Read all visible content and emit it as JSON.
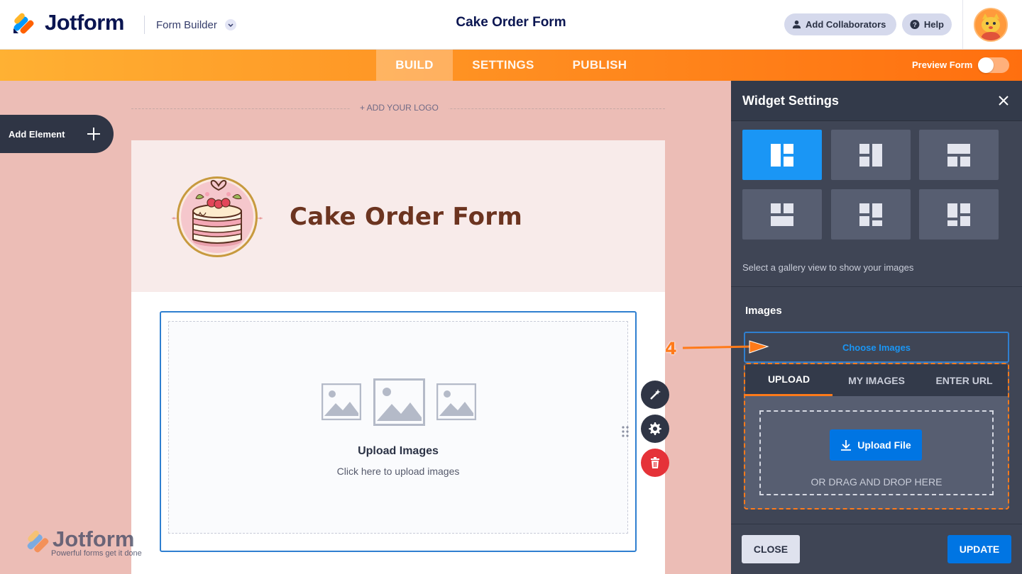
{
  "topbar": {
    "brand": "Jotform",
    "builder_label": "Form Builder",
    "form_title": "Cake Order Form",
    "add_collaborators": "Add Collaborators",
    "help": "Help"
  },
  "nav": {
    "tabs": [
      {
        "label": "BUILD",
        "active": true
      },
      {
        "label": "SETTINGS",
        "active": false
      },
      {
        "label": "PUBLISH",
        "active": false
      }
    ],
    "preview_label": "Preview Form",
    "preview_on": false
  },
  "canvas": {
    "add_element": "Add Element",
    "add_logo": "+ ADD YOUR LOGO",
    "header_title": "Cake Order Form",
    "upload_title": "Upload Images",
    "upload_subtitle": "Click here to upload images"
  },
  "watermark": {
    "brand": "Jotform",
    "tagline": "Powerful forms get it done"
  },
  "panel": {
    "title": "Widget Settings",
    "layout_hint": "Select a gallery view to show your images",
    "layout_selected_index": 0,
    "images_label": "Images",
    "choose_images": "Choose Images",
    "upload_tabs": [
      {
        "label": "UPLOAD",
        "active": true
      },
      {
        "label": "MY IMAGES",
        "active": false
      },
      {
        "label": "ENTER URL",
        "active": false
      }
    ],
    "upload_file": "Upload File",
    "drag_drop": "OR DRAG AND DROP HERE",
    "close": "CLOSE",
    "update": "UPDATE"
  },
  "annotation": {
    "step": "4"
  },
  "colors": {
    "accent_orange": "#ff7a1a",
    "primary_blue": "#0075e3",
    "panel_bg": "#3f4555",
    "canvas_bg": "#ecbdb6"
  }
}
